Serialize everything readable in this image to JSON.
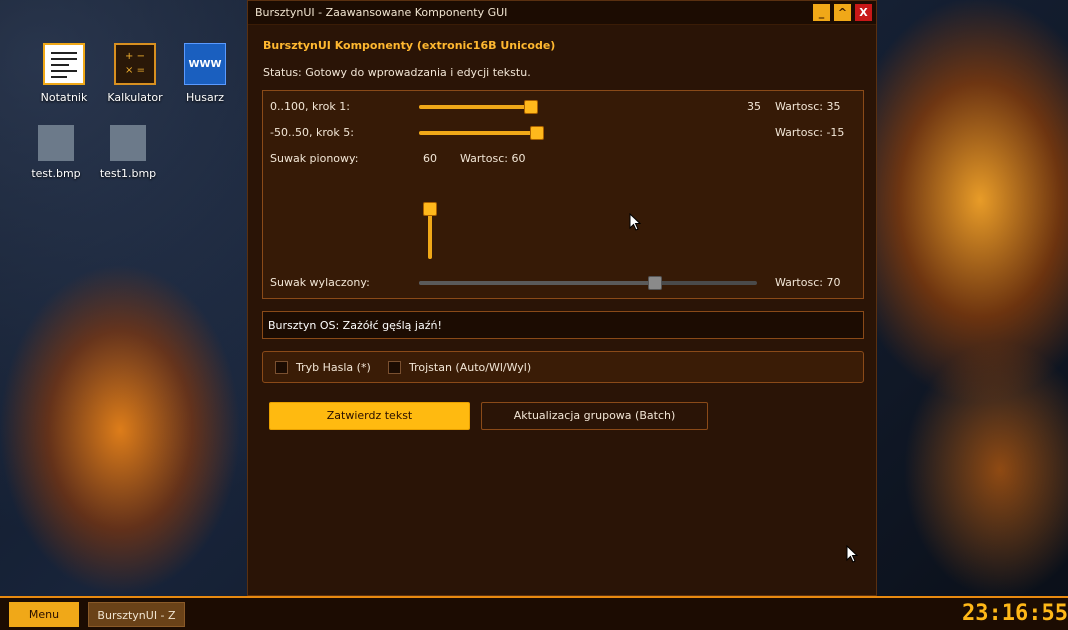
{
  "desktop": {
    "icons": [
      {
        "label": "Notatnik",
        "icon": "notepad-icon"
      },
      {
        "label": "Kalkulator",
        "icon": "calculator-icon",
        "glyph": "+ −\n× ="
      },
      {
        "label": "Husarz",
        "icon": "browser-icon",
        "glyph": "WWW"
      },
      {
        "label": "test.bmp",
        "icon": "bmp-file-icon"
      },
      {
        "label": "test1.bmp",
        "icon": "bmp-file-icon"
      }
    ]
  },
  "window": {
    "title": "BursztynUI - Zaawansowane Komponenty GUI",
    "controls": {
      "minimize": "_",
      "maximize": "^",
      "close": "X"
    },
    "header": "BursztynUI Komponenty (extronic16B Unicode)",
    "status": "Status: Gotowy do wprowadzania i edycji tekstu.",
    "sliders": {
      "s1": {
        "label": "0..100, krok 1:",
        "value_display": "35",
        "value_text": "Wartosc: 35",
        "min": 0,
        "max": 100,
        "value": 35
      },
      "s2": {
        "label": "-50..50, krok 5:",
        "value_text": "Wartosc: -15",
        "min": -50,
        "max": 50,
        "value": -15
      },
      "vertical": {
        "label": "Suwak pionowy:",
        "value_display": "60",
        "value_text": "Wartosc: 60",
        "value": 60
      },
      "disabled": {
        "label": "Suwak wylaczony:",
        "value_text": "Wartosc: 70",
        "value": 70
      }
    },
    "textbox": {
      "value": "Bursztyn OS: Zażółć gęślą jaźń!"
    },
    "checkboxes": {
      "password": {
        "label": "Tryb Hasla (*)",
        "checked": false
      },
      "tristate": {
        "label": "Trojstan (Auto/Wl/Wyl)",
        "checked": false
      }
    },
    "buttons": {
      "confirm": "Zatwierdz tekst",
      "batch": "Aktualizacja grupowa (Batch)"
    }
  },
  "taskbar": {
    "menu": "Menu",
    "task": "BursztynUI - Z",
    "clock": "23:16:55"
  },
  "colors": {
    "accent": "#f0a818",
    "window_bg": "#2a1406",
    "panel_border": "#8a4a18"
  }
}
